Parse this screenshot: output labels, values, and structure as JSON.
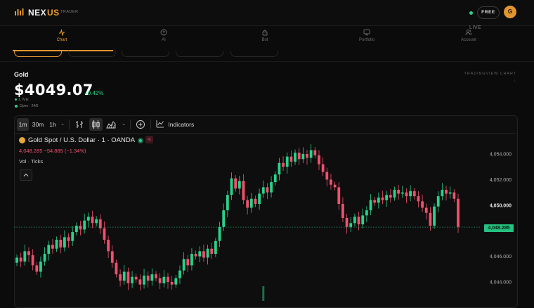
{
  "app": {
    "brand_part1": "NEX",
    "brand_part2": "US",
    "brand_sub": "TRADER",
    "plan_badge": "FREE",
    "avatar_initial": "G",
    "accent_color": "#e0952f"
  },
  "nav": {
    "items": [
      {
        "label": "Chart",
        "icon": "activity-icon",
        "active": true
      },
      {
        "label": "AI",
        "icon": "help-circle-icon",
        "active": false
      },
      {
        "label": "Bot",
        "icon": "lock-icon",
        "active": false
      },
      {
        "label": "Portfolio",
        "icon": "monitor-icon",
        "active": false
      },
      {
        "label": "Account",
        "icon": "users-icon",
        "active": false
      }
    ],
    "live_label": "LIVE"
  },
  "asset": {
    "name": "Gold",
    "price": "$4049.07",
    "change": "+0.42%",
    "live": "LIVE",
    "market_status": "Open · 24/5",
    "tv_label": "TRADINGVIEW CHART ↓"
  },
  "chart": {
    "toolbar": {
      "intervals": [
        "1m",
        "30m",
        "1h"
      ],
      "interval_caret": "⌄",
      "active_interval": "1m",
      "indicators_label": "Indicators"
    },
    "legend": {
      "title": "Gold Spot / U.S. Dollar · 1 · OANDA",
      "ohlc": "4,048.285  −54.885 (−1.34%)",
      "vol_label": "Vol · Ticks"
    },
    "price_axis": {
      "ticks": [
        "4,054.000",
        "4,052.000",
        "4,050.000",
        "4,046.000",
        "4,044.000"
      ],
      "last_price": "4,048.285"
    },
    "colors": {
      "up": "#26d38c",
      "down": "#f0506e"
    }
  },
  "chart_data": {
    "type": "candlestick",
    "title": "Gold Spot / U.S. Dollar · 1 · OANDA",
    "ylabel": "",
    "ylim": [
      4043.4,
      4055.4
    ],
    "last_price": 4048.285,
    "y_ticks": [
      4054,
      4052,
      4050,
      4046,
      4044
    ],
    "closes": [
      4045.9,
      4045.6,
      4046.4,
      4046.1,
      4045.3,
      4044.8,
      4045.6,
      4046.2,
      4046.9,
      4046.6,
      4047.3,
      4046.7,
      4047.5,
      4047.2,
      4047.9,
      4048.4,
      4048.1,
      4048.8,
      4049.1,
      4048.6,
      4048.9,
      4048.2,
      4047.3,
      4046.4,
      4045.5,
      4044.6,
      4044.1,
      4044.8,
      4043.9,
      4044.4,
      4044.2,
      4043.8,
      4044.5,
      4044.1,
      4044.6,
      4044.3,
      4043.9,
      4044.4,
      4044.0,
      4043.8,
      4044.3,
      4044.9,
      4045.8,
      4045.3,
      4046.2,
      4046.0,
      4046.4,
      4045.9,
      4046.6,
      4046.2,
      4047.2,
      4048.3,
      4049.6,
      4050.8,
      4052.1,
      4051.3,
      4051.9,
      4050.4,
      4049.8,
      4050.5,
      4050.1,
      4050.9,
      4051.4,
      4051.0,
      4051.8,
      4052.4,
      4053.3,
      4053.0,
      4053.8,
      4053.4,
      4054.1,
      4053.6,
      4054.0,
      4053.7,
      4054.3,
      4053.9,
      4053.2,
      4052.6,
      4052.0,
      4051.6,
      4051.4,
      4050.1,
      4049.0,
      4048.3,
      4048.6,
      4049.1,
      4048.5,
      4049.2,
      4049.6,
      4050.4,
      4050.2,
      4050.6,
      4050.4,
      4050.8,
      4050.6,
      4051.2,
      4050.9,
      4051.0,
      4050.7,
      4051.1,
      4050.7,
      4050.3,
      4049.8,
      4049.4,
      4048.4,
      4049.9,
      4050.7,
      4051.2,
      4050.9,
      4051.0,
      4050.5,
      4048.3
    ],
    "volume_bar_index": 62
  }
}
